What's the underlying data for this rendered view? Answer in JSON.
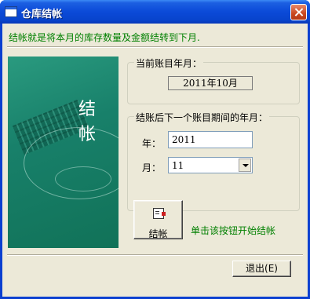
{
  "window": {
    "title": "仓库结帐"
  },
  "intro_text": "结帐就是将本月的库存数量及金额结转到下月.",
  "banner": {
    "text": "结帐"
  },
  "current_period": {
    "group_title": "当前账目年月：",
    "value": "2011年10月"
  },
  "next_period": {
    "group_title": "结账后下一个账目期间的年月：",
    "year_label": "年：",
    "year_value": "2011",
    "month_label": "月：",
    "month_value": "11"
  },
  "actions": {
    "close_period_label": "结帐",
    "close_period_icon": "document-icon",
    "hint": "单击该按钮开始结帐",
    "exit_label": "退出(E)"
  }
}
